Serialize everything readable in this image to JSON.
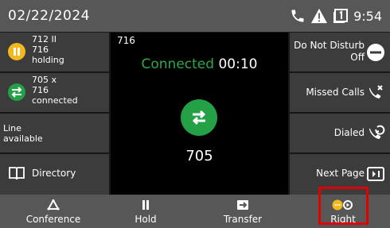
{
  "status": {
    "date": "02/22/2024",
    "time": "9:54",
    "icons": [
      "phone-icon",
      "warning-icon",
      "screen-icon"
    ]
  },
  "left_keys": {
    "call1": {
      "lines": [
        "712 II",
        "716",
        "holding"
      ],
      "icon": "pause-icon",
      "color": "#f5b81c"
    },
    "call2": {
      "lines": [
        "705 x",
        "716",
        "connected"
      ],
      "icon": "transfer-arrows-icon",
      "color": "#24a046"
    },
    "line": {
      "lines": [
        "Line",
        "available"
      ]
    },
    "directory": {
      "label": "Directory",
      "icon": "book-icon"
    }
  },
  "center": {
    "line_number": "716",
    "status": "Connected",
    "timer": "00:10",
    "number": "705",
    "icon": "transfer-arrows-icon",
    "status_color": "#2ea84a"
  },
  "right_keys": {
    "dnd": {
      "label": "Do Not Disturb",
      "value": "Off",
      "icon": "minus-circle-icon"
    },
    "missed": {
      "label": "Missed Calls",
      "icon": "missed-call-icon"
    },
    "dialed": {
      "label": "Dialed",
      "icon": "dialed-call-icon"
    },
    "next": {
      "label": "Next Page",
      "icon": "next-page-icon"
    }
  },
  "softkeys": [
    {
      "label": "Conference",
      "icon": "conference-icon"
    },
    {
      "label": "Hold",
      "icon": "pause-icon"
    },
    {
      "label": "Transfer",
      "icon": "transfer-icon"
    },
    {
      "label": "Right",
      "icon": "more-right-icon"
    }
  ],
  "highlight_color": "#e00000"
}
